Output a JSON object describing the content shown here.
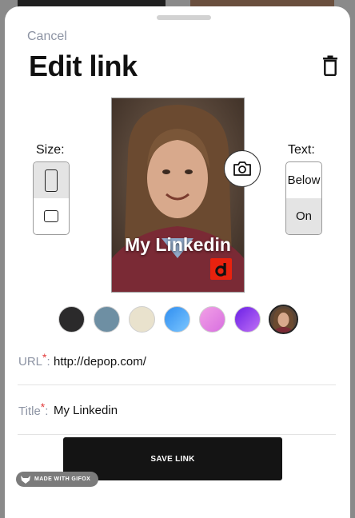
{
  "header": {
    "cancel_label": "Cancel",
    "title": "Edit link",
    "delete_icon": "trash-icon"
  },
  "size_picker": {
    "label": "Size:",
    "options": [
      {
        "icon": "portrait-size-icon",
        "selected": true
      },
      {
        "icon": "square-size-icon",
        "selected": false
      }
    ]
  },
  "text_picker": {
    "label": "Text:",
    "options": [
      {
        "label": "Below",
        "selected": false
      },
      {
        "label": "On",
        "selected": true
      }
    ]
  },
  "preview": {
    "caption": "My Linkedin",
    "logo_text": "d",
    "camera_icon": "camera-icon"
  },
  "swatches": [
    {
      "name": "black",
      "color": "#2b2a2b"
    },
    {
      "name": "slate-blue",
      "color": "#6e8fa3"
    },
    {
      "name": "beige",
      "color": "#e9e2cd"
    },
    {
      "name": "blue-gradient",
      "color": "#3aa0f0"
    },
    {
      "name": "pink-gradient",
      "color": "#e98fe0"
    },
    {
      "name": "purple-gradient",
      "color": "#8a3df0"
    },
    {
      "name": "photo",
      "color": "#6b5443",
      "selected": true
    }
  ],
  "fields": {
    "url": {
      "label": "URL",
      "required_mark": "*",
      "separator": ":",
      "value": "http://depop.com/"
    },
    "title": {
      "label": "Title",
      "required_mark": "*",
      "separator": ":",
      "value": "My Linkedin"
    }
  },
  "save_button": {
    "label": "SAVE LINK"
  },
  "watermark": {
    "text": "MADE WITH GIFOX"
  },
  "colors": {
    "accent": "#141414",
    "required": "#e23b3b",
    "muted": "#8c93a3"
  }
}
